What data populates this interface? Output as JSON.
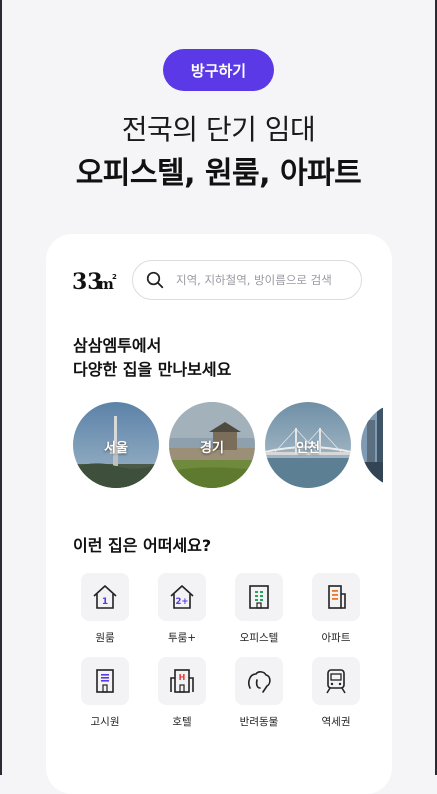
{
  "banner": {
    "badge_label": "방구하기",
    "title_line1": "전국의 단기 임대",
    "title_line2": "오피스텔, 원룸, 아파트"
  },
  "header": {
    "logo_text": "33m²",
    "search_placeholder": "지역, 지하철역, 방이름으로 검색"
  },
  "promo": {
    "line1": "삼삼엠투에서",
    "line2": "다양한 집을 만나보세요"
  },
  "regions": [
    {
      "label": "서울"
    },
    {
      "label": "경기"
    },
    {
      "label": "인천"
    },
    {
      "label": ""
    }
  ],
  "house_types": {
    "title": "이런 집은 어떠세요?",
    "items": [
      {
        "label": "원룸",
        "icon": "one-room-icon"
      },
      {
        "label": "투룸+",
        "icon": "two-room-icon"
      },
      {
        "label": "오피스텔",
        "icon": "officetel-icon"
      },
      {
        "label": "아파트",
        "icon": "apartment-icon"
      },
      {
        "label": "고시원",
        "icon": "gosiwon-icon"
      },
      {
        "label": "호텔",
        "icon": "hotel-icon"
      },
      {
        "label": "반려동물",
        "icon": "pet-icon"
      },
      {
        "label": "역세권",
        "icon": "subway-icon"
      }
    ]
  },
  "colors": {
    "accent": "#5b39e6",
    "icon_accent": "#5b39e6",
    "icon_green": "#27a35a",
    "icon_orange": "#e8792a",
    "icon_red": "#e53935"
  }
}
